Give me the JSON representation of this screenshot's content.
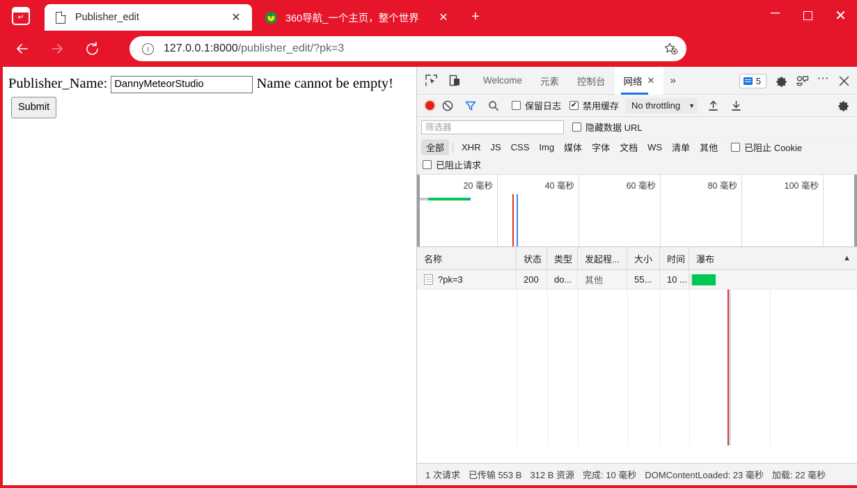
{
  "window": {
    "controls": {
      "minimize": "—",
      "maximize": "□",
      "close": "✕"
    },
    "accent_color": "#e6152a"
  },
  "tabs": [
    {
      "title": "Publisher_edit",
      "favicon": "document-icon",
      "active": true,
      "close": "✕"
    },
    {
      "title": "360导航_一个主页，整个世界",
      "favicon": "360-icon",
      "active": false,
      "close": "✕"
    }
  ],
  "newtab_label": "+",
  "toolbar": {
    "back": "←",
    "forward": "→",
    "reload": "⟳",
    "info_icon": "i",
    "url_host": "127.0.0.1:8000",
    "url_path": "/publisher_edit/?pk=3",
    "url_full": "127.0.0.1:8000/publisher_edit/?pk=3",
    "favorite_icon": "add-favorite-star-icon",
    "favorites_icon": "favorites-list-icon",
    "collections_icon": "collections-add-icon",
    "profile_icon": "avatar",
    "settings_icon": "more-options-icon"
  },
  "page": {
    "label": "Publisher_Name:",
    "input_value": "DannyMeteorStudio",
    "input_placeholder": "",
    "error_text": "Name cannot be empty!",
    "submit_label": "Submit"
  },
  "devtools": {
    "inspect_icon": "inspect-element-icon",
    "device_icon": "device-toolbar-icon",
    "tabs": [
      {
        "label": "Welcome",
        "selected": false
      },
      {
        "label": "元素",
        "selected": false
      },
      {
        "label": "控制台",
        "selected": false
      },
      {
        "label": "网络",
        "selected": true,
        "close": "✕"
      }
    ],
    "more_tabs": "»",
    "message_count": "5",
    "message_icon": "messages-icon",
    "settings_icon": "gear-icon",
    "customize_icon": "customize-devtools-icon",
    "more_icon": "more-options-icon",
    "close_icon": "close-devtools-icon",
    "network_toolbar": {
      "record_icon": "record-icon",
      "clear_icon": "clear-icon",
      "filter_icon": "filter-icon",
      "search_icon": "search-icon",
      "preserve_log_label": "保留日志",
      "preserve_log_checked": false,
      "disable_cache_label": "禁用缓存",
      "disable_cache_checked": true,
      "throttle_value": "No throttling",
      "throttle_caret": "▼",
      "import_icon": "import-har-icon",
      "export_icon": "export-har-icon",
      "settings_icon": "network-settings-icon"
    },
    "filter": {
      "placeholder": "筛选器",
      "value": "",
      "hide_data_urls_label": "隐藏数据 URL",
      "hide_data_urls_checked": false,
      "types": [
        "全部",
        "XHR",
        "JS",
        "CSS",
        "Img",
        "媒体",
        "字体",
        "文档",
        "WS",
        "清单",
        "其他"
      ],
      "selected_type": "全部",
      "blocked_cookies_label": "已阻止 Cookie",
      "blocked_cookies_checked": false,
      "blocked_requests_label": "已阻止请求",
      "blocked_requests_checked": false
    },
    "overview": {
      "ticks": [
        "20 毫秒",
        "40 毫秒",
        "60 毫秒",
        "80 毫秒",
        "100 毫秒"
      ]
    },
    "table": {
      "columns": [
        "名称",
        "状态",
        "类型",
        "发起程...",
        "大小",
        "时间",
        "瀑布"
      ],
      "sort_indicator": "▲",
      "rows": [
        {
          "name": "?pk=3",
          "status": "200",
          "type": "do...",
          "initiator": "其他",
          "size": "55...",
          "time": "10 ...",
          "waterfall": ""
        }
      ]
    },
    "status": [
      "1 次请求",
      "已传输 553 B",
      "312 B 资源",
      "完成: 10 毫秒",
      "DOMContentLoaded: 23 毫秒",
      "加载: 22 毫秒"
    ]
  }
}
